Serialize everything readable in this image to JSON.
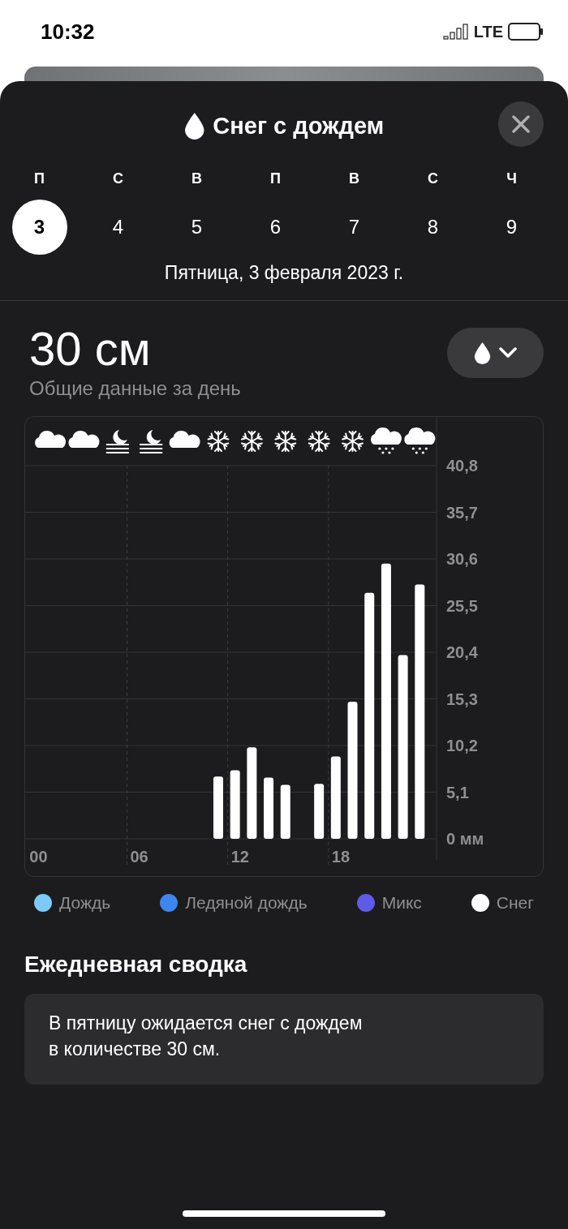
{
  "status_bar": {
    "time": "10:32",
    "network": "LTE"
  },
  "sheet": {
    "title": "Снег с дождем"
  },
  "days": [
    {
      "weekday": "П",
      "date": "3",
      "selected": true
    },
    {
      "weekday": "С",
      "date": "4",
      "selected": false
    },
    {
      "weekday": "В",
      "date": "5",
      "selected": false
    },
    {
      "weekday": "П",
      "date": "6",
      "selected": false
    },
    {
      "weekday": "В",
      "date": "7",
      "selected": false
    },
    {
      "weekday": "С",
      "date": "8",
      "selected": false
    },
    {
      "weekday": "Ч",
      "date": "9",
      "selected": false
    }
  ],
  "full_date": "Пятница, 3 февраля 2023 г.",
  "total": {
    "value": "30 см",
    "caption": "Общие данные за день"
  },
  "hourly_icons": [
    {
      "kind": "cloud"
    },
    {
      "kind": "cloud"
    },
    {
      "kind": "moon-fog"
    },
    {
      "kind": "moon-fog"
    },
    {
      "kind": "cloud"
    },
    {
      "kind": "snowflake"
    },
    {
      "kind": "snowflake"
    },
    {
      "kind": "snowflake"
    },
    {
      "kind": "snowflake"
    },
    {
      "kind": "snowflake"
    },
    {
      "kind": "cloud-snow"
    },
    {
      "kind": "cloud-snow"
    }
  ],
  "chart_data": {
    "type": "bar",
    "x": [
      11,
      12,
      13,
      14,
      15,
      17,
      18,
      19,
      20,
      21,
      22,
      23
    ],
    "series": [
      {
        "color": "#ffffff",
        "values": [
          6.8,
          7.5,
          10.0,
          6.7,
          5.9,
          6.0,
          9.0,
          15.0,
          26.9,
          30.1,
          20.1,
          27.8
        ]
      }
    ],
    "xlim": [
      -0.5,
      24
    ],
    "grid": true,
    "ylim": [
      0,
      40.8
    ],
    "yticks": [
      {
        "value": 0,
        "label": "0 мм"
      },
      {
        "value": 5.1,
        "label": "5,1"
      },
      {
        "value": 10.2,
        "label": "10,2"
      },
      {
        "value": 15.3,
        "label": "15,3"
      },
      {
        "value": 20.4,
        "label": "20,4"
      },
      {
        "value": 25.5,
        "label": "25,5"
      },
      {
        "value": 30.6,
        "label": "30,6"
      },
      {
        "value": 35.7,
        "label": "35,7"
      },
      {
        "value": 40.8,
        "label": "40,8"
      }
    ],
    "xticks": [
      {
        "value": 0,
        "label": "00"
      },
      {
        "value": 6,
        "label": "06"
      },
      {
        "value": 12,
        "label": "12"
      },
      {
        "value": 18,
        "label": "18"
      }
    ]
  },
  "legend": [
    {
      "label": "Дождь",
      "color": "#7dcaf8"
    },
    {
      "label": "Ледяной дождь",
      "color": "#3d86f0"
    },
    {
      "label": "Микс",
      "color": "#5e5ce6"
    },
    {
      "label": "Снег",
      "color": "#ffffff"
    }
  ],
  "summary": {
    "title": "Ежедневная сводка",
    "text": "В пятницу ожидается снег с дождем\nв количестве 30 см."
  }
}
